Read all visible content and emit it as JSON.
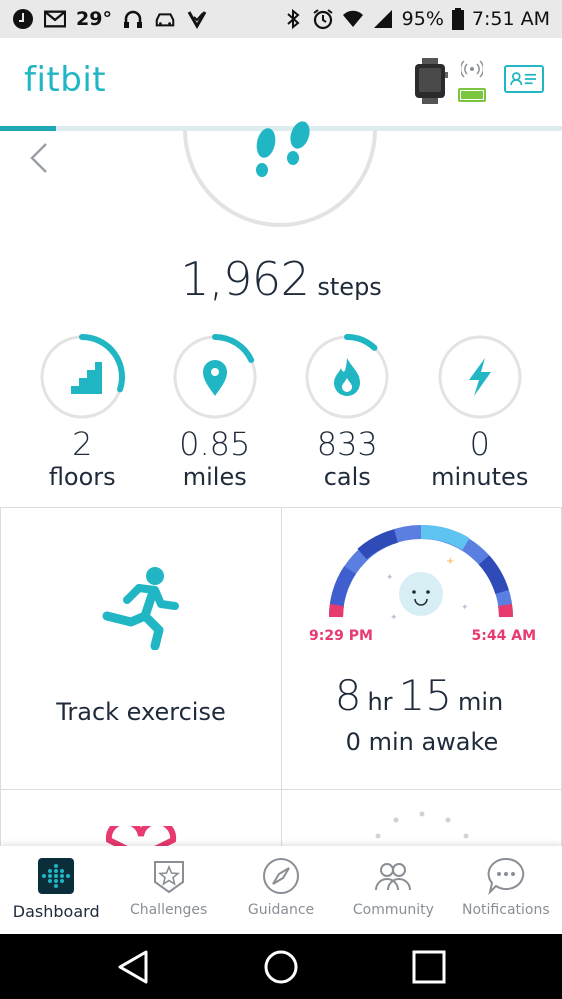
{
  "statusbar": {
    "temperature": "29°",
    "battery": "95%",
    "time": "7:51 AM"
  },
  "app": {
    "logo": "fitbit",
    "colors": {
      "teal": "#21b6c4",
      "pink": "#e83a6e",
      "battery_green": "#7cc63f"
    },
    "top_progress": 0.1
  },
  "steps": {
    "count": "1,962",
    "unit": "steps"
  },
  "stats": [
    {
      "value": "2",
      "label": "floors",
      "icon": "stairs-icon",
      "progress": 0.3
    },
    {
      "value": "0.85",
      "label": "miles",
      "icon": "location-pin-icon",
      "progress": 0.18
    },
    {
      "value": "833",
      "label": "cals",
      "icon": "flame-icon",
      "progress": 0.12
    },
    {
      "value": "0",
      "label": "minutes",
      "icon": "lightning-icon",
      "progress": 0
    }
  ],
  "tiles": {
    "exercise": {
      "label": "Track exercise",
      "icon": "runner-icon"
    },
    "sleep": {
      "start": "9:29 PM",
      "end": "5:44 AM",
      "hours": "8",
      "hours_unit": "hr",
      "minutes": "15",
      "minutes_unit": "min",
      "awake": "0 min awake",
      "icon": "moon-icon"
    }
  },
  "bottom_nav": [
    {
      "label": "Dashboard",
      "icon": "dashboard-icon",
      "active": true
    },
    {
      "label": "Challenges",
      "icon": "challenges-star-icon",
      "active": false
    },
    {
      "label": "Guidance",
      "icon": "compass-icon",
      "active": false
    },
    {
      "label": "Community",
      "icon": "community-people-icon",
      "active": false
    },
    {
      "label": "Notifications",
      "icon": "chat-bubble-icon",
      "active": false
    }
  ]
}
